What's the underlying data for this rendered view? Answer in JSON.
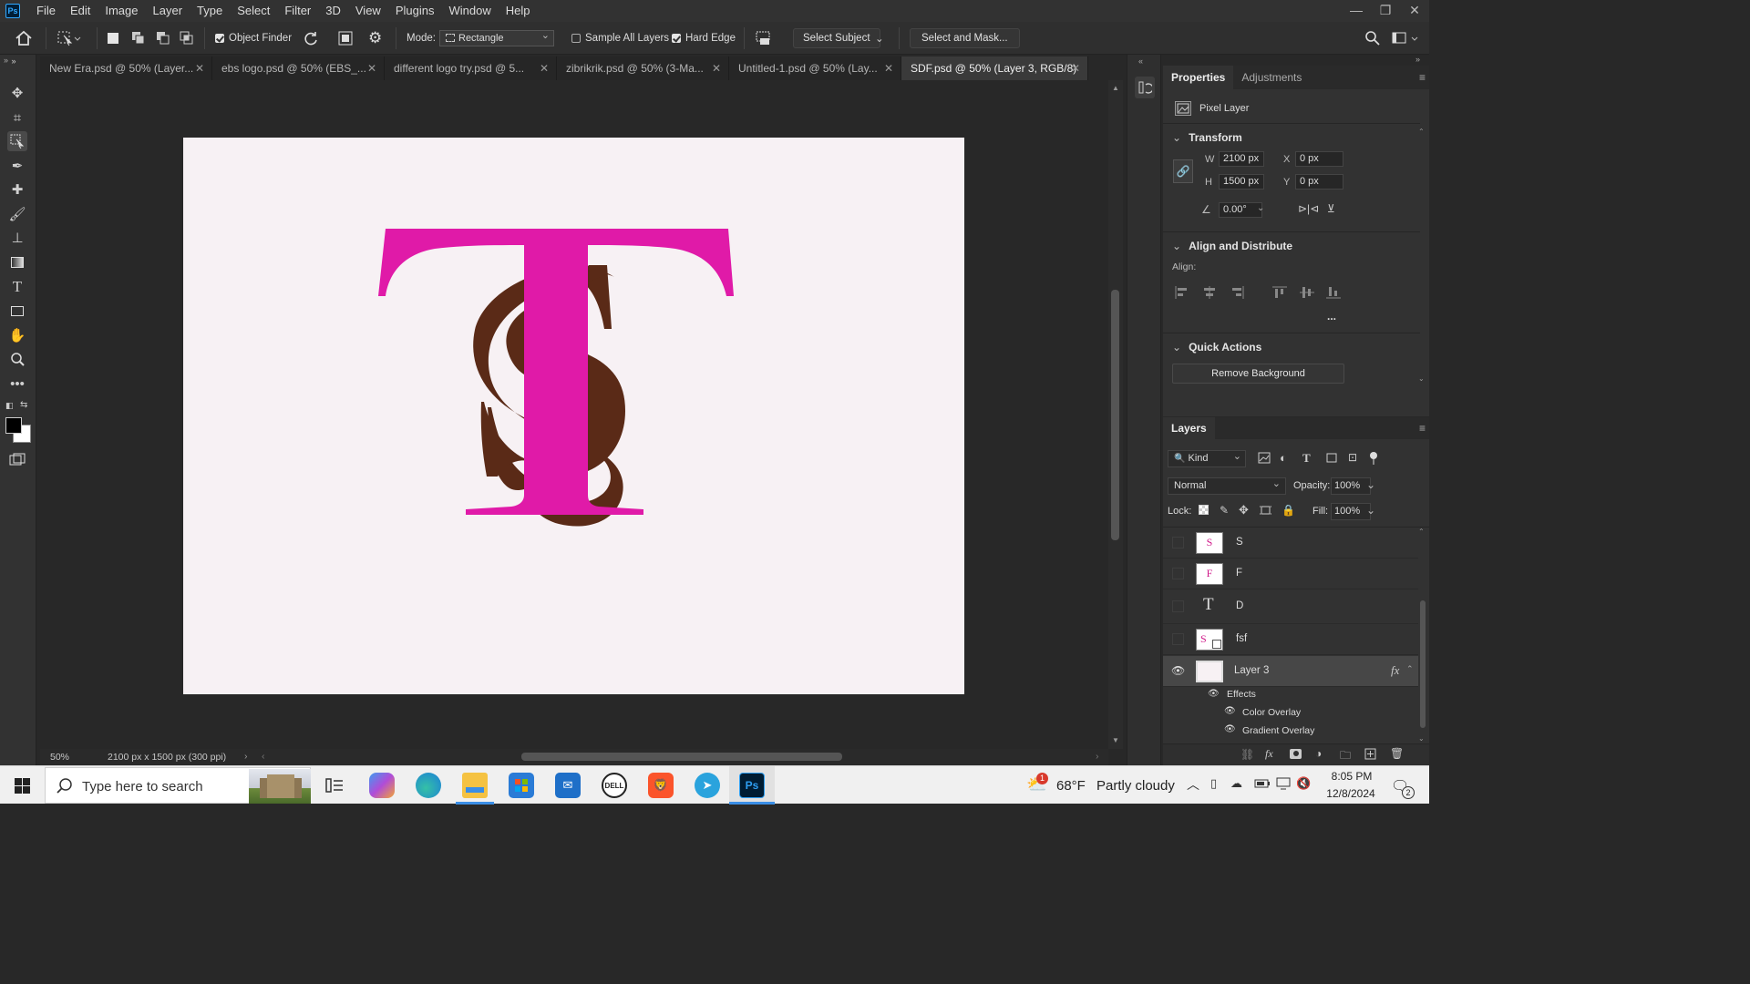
{
  "menubar": {
    "app_logo": "Ps",
    "items": [
      "File",
      "Edit",
      "Image",
      "Layer",
      "Type",
      "Select",
      "Filter",
      "3D",
      "View",
      "Plugins",
      "Window",
      "Help"
    ]
  },
  "options": {
    "object_finder": "Object Finder",
    "mode_label": "Mode:",
    "mode_value": "Rectangle",
    "sample_all_layers": "Sample All Layers",
    "hard_edge": "Hard Edge",
    "select_subject": "Select Subject",
    "select_and_mask": "Select and Mask..."
  },
  "tabs": [
    {
      "label": "New Era.psd @ 50% (Layer...",
      "active": false
    },
    {
      "label": "ebs logo.psd @ 50% (EBS_...",
      "active": false
    },
    {
      "label": "different logo try.psd @ 5...",
      "active": false
    },
    {
      "label": "zibrikrik.psd @ 50% (3-Ma...",
      "active": false
    },
    {
      "label": "Untitled-1.psd @ 50% (Lay...",
      "active": false
    },
    {
      "label": "SDF.psd @ 50% (Layer 3, RGB/8)",
      "active": true
    }
  ],
  "status": {
    "zoom": "50%",
    "doc_info": "2100 px x 1500 px (300 ppi)"
  },
  "properties": {
    "tab_properties": "Properties",
    "tab_adjustments": "Adjustments",
    "layer_type": "Pixel Layer",
    "transform_title": "Transform",
    "w_label": "W",
    "w_value": "2100 px",
    "h_label": "H",
    "h_value": "1500 px",
    "x_label": "X",
    "x_value": "0 px",
    "y_label": "Y",
    "y_value": "0 px",
    "angle_value": "0.00°",
    "align_title": "Align and Distribute",
    "align_label": "Align:",
    "more": "...",
    "quick_actions_title": "Quick Actions",
    "remove_background": "Remove Background"
  },
  "layers_panel": {
    "title": "Layers",
    "kind": "Kind",
    "blend_mode": "Normal",
    "opacity_label": "Opacity:",
    "opacity_value": "100%",
    "lock_label": "Lock:",
    "fill_label": "Fill:",
    "fill_value": "100%",
    "layers": [
      {
        "name": "S",
        "visible": false,
        "thumb": "S"
      },
      {
        "name": "F",
        "visible": false,
        "thumb": "F"
      },
      {
        "name": "D",
        "visible": false,
        "thumb": "T"
      },
      {
        "name": "fsf",
        "visible": false,
        "thumb": "S"
      },
      {
        "name": "Layer 3",
        "visible": true,
        "selected": true
      }
    ],
    "effects_label": "Effects",
    "effect_1": "Color Overlay",
    "effect_2": "Gradient Overlay",
    "fx": "fx"
  },
  "canvas": {
    "t_color": "#e01aa8",
    "s_color": "#5a2a17",
    "bg_color": "#f7f1f4"
  },
  "taskbar": {
    "search_placeholder": "Type here to search",
    "weather_temp": "68°F",
    "weather_desc": "Partly cloudy",
    "weather_badge": "1",
    "time": "8:05 PM",
    "date": "12/8/2024",
    "notification_count": "2"
  }
}
